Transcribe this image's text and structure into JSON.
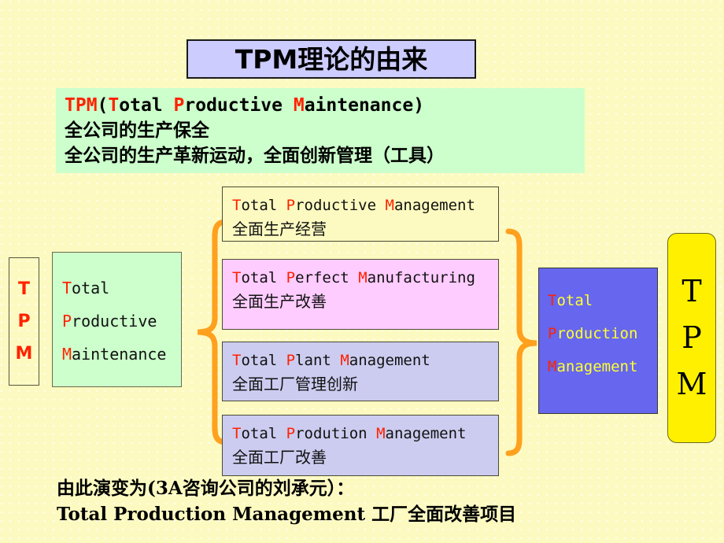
{
  "slide": {
    "background_color": "#FCFAC0",
    "title": "TPM理论的由来",
    "accent_red": "#FF2200",
    "brace_color": "#FFA01E"
  },
  "definition": {
    "box_color": "#CCFFCC",
    "line1_prefix": "TPM",
    "line1_open": "(",
    "line1_t": "T",
    "line1_otal": "otal ",
    "line1_p": "P",
    "line1_roductive": "roductive ",
    "line1_m": "M",
    "line1_aintenance": "aintenance",
    "line1_close": ")",
    "line2": "全公司的生产保全",
    "line3": "全公司的生产革新运动，全面创新管理（工具）"
  },
  "tpm_strip": {
    "letters": [
      "T",
      "P",
      "M"
    ]
  },
  "tpm_green": {
    "box_color": "#CCFFCC",
    "words": [
      {
        "initial": "T",
        "rest": "otal"
      },
      {
        "initial": "P",
        "rest": "roductive"
      },
      {
        "initial": "M",
        "rest": "aintenance"
      }
    ]
  },
  "middle_boxes": [
    {
      "color": "#FCFAC0",
      "en": [
        {
          "initial": "T",
          "rest": "otal "
        },
        {
          "initial": "P",
          "rest": "roductive "
        },
        {
          "initial": "M",
          "rest": "anagement"
        }
      ],
      "cn": "全面生产经营"
    },
    {
      "color": "#FFCCFF",
      "en": [
        {
          "initial": "T",
          "rest": "otal "
        },
        {
          "initial": "P",
          "rest": "erfect "
        },
        {
          "initial": "M",
          "rest": "anufacturing"
        }
      ],
      "cn": "全面生产改善"
    },
    {
      "color": "#CCCCF0",
      "en": [
        {
          "initial": "T",
          "rest": "otal "
        },
        {
          "initial": "P",
          "rest": "lant "
        },
        {
          "initial": "M",
          "rest": "anagement"
        }
      ],
      "cn": "全面工厂管理创新"
    },
    {
      "color": "#CCCCF0",
      "en": [
        {
          "initial": "T",
          "rest": "otal "
        },
        {
          "initial": "P",
          "rest": "rodution "
        },
        {
          "initial": "M",
          "rest": "anagement"
        }
      ],
      "cn": "全面工厂改善"
    }
  ],
  "blue_box": {
    "color": "#6666EE",
    "text_color": "#FFFF33",
    "words": [
      {
        "initial": "T",
        "rest": "otal"
      },
      {
        "initial": "P",
        "rest": "roduction"
      },
      {
        "initial": "M",
        "rest": "anagement"
      }
    ]
  },
  "tpm_yellow": {
    "color": "#FFF000",
    "letters": [
      "T",
      "P",
      "M"
    ]
  },
  "footer": {
    "line1": "由此演变为(3A咨询公司的刘承元）：",
    "line2": "Total Production Management  工厂全面改善项目"
  }
}
